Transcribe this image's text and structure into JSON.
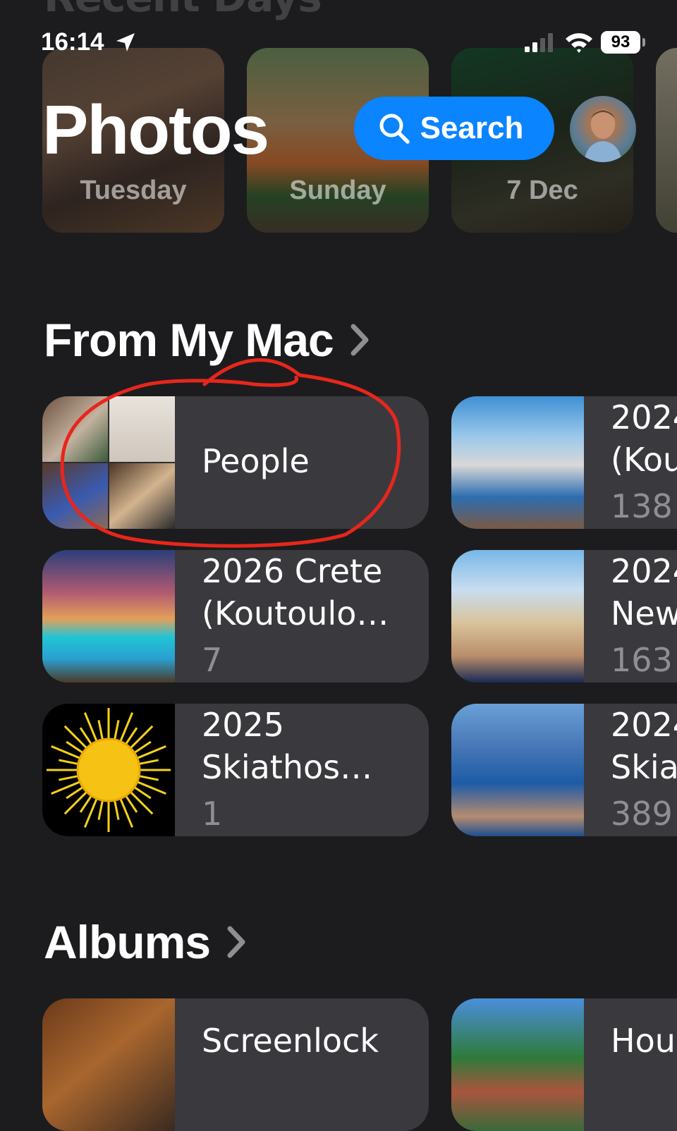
{
  "status_bar": {
    "time": "16:14",
    "battery": "93"
  },
  "recent_days": {
    "title": "Recent Days",
    "cards": [
      {
        "label": "Tuesday"
      },
      {
        "label": "Sunday"
      },
      {
        "label": "7 Dec"
      }
    ]
  },
  "header": {
    "title": "Photos",
    "search_label": "Search"
  },
  "from_my_mac": {
    "title": "From My Mac",
    "items": [
      {
        "title": "People"
      },
      {
        "title_line1": "2026 Crete",
        "title_line2": "(Koutoulo…",
        "count": "7"
      },
      {
        "title_line1": "2025",
        "title_line2": "Skiathos…",
        "count": "1"
      }
    ],
    "right_items": [
      {
        "title_line1": "2024",
        "title_line2": "(Kou",
        "count": "138"
      },
      {
        "title_line1": "2024",
        "title_line2": "New",
        "count": "163"
      },
      {
        "title_line1": "2024",
        "title_line2": "Skia",
        "count": "389"
      }
    ]
  },
  "albums": {
    "title": "Albums",
    "items": [
      {
        "title": "Screenlock"
      }
    ],
    "right_items": [
      {
        "title": "Hou"
      }
    ]
  },
  "colors": {
    "accent": "#0a84ff",
    "background": "#1c1c1e",
    "card": "#3a3a3e",
    "annotation": "#e8261c"
  },
  "icons": [
    "location-arrow-icon",
    "cellular-signal-icon",
    "wifi-icon",
    "battery-icon",
    "search-icon",
    "chevron-right-icon"
  ]
}
